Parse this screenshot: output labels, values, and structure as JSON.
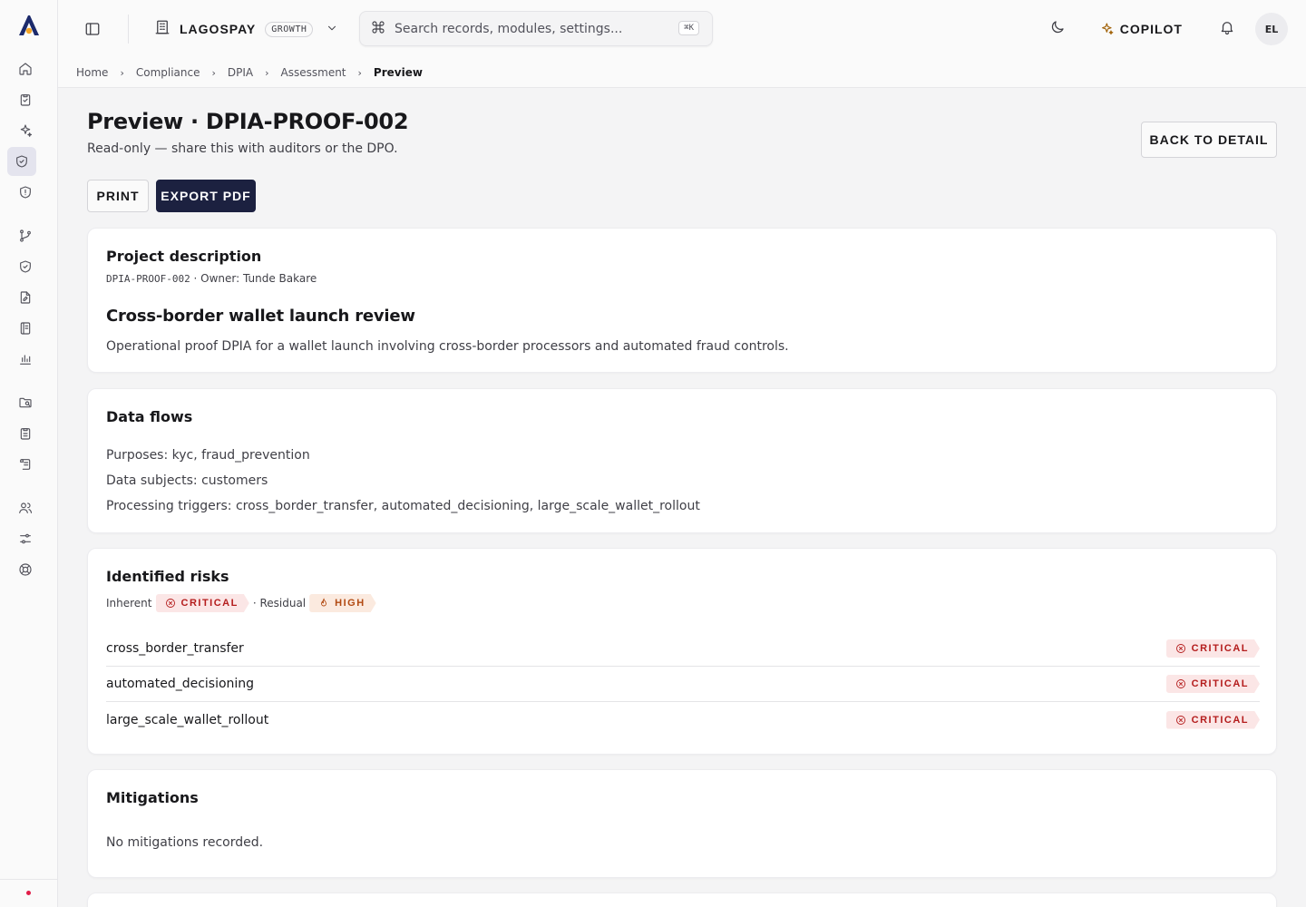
{
  "topbar": {
    "org_name": "LAGOSPAY",
    "plan": "GROWTH",
    "search_placeholder": "Search records, modules, settings...",
    "search_shortcut": "⌘K",
    "copilot_label": "COPILOT",
    "avatar_initials": "EL"
  },
  "breadcrumb": [
    "Home",
    "Compliance",
    "DPIA",
    "Assessment",
    "Preview"
  ],
  "header": {
    "title": "Preview · DPIA-PROOF-002",
    "subtitle": "Read-only — share this with auditors or the DPO.",
    "back_label": "BACK TO DETAIL",
    "print_label": "PRINT",
    "export_label": "EXPORT PDF"
  },
  "project": {
    "section_title": "Project description",
    "id": "DPIA-PROOF-002",
    "owner_text": " · Owner: Tunde Bakare",
    "name": "Cross-border wallet launch review",
    "description": "Operational proof DPIA for a wallet launch involving cross-border processors and automated fraud controls."
  },
  "data_flows": {
    "section_title": "Data flows",
    "purposes": "Purposes: kyc, fraud_prevention",
    "subjects": "Data subjects: customers",
    "triggers": "Processing triggers: cross_border_transfer, automated_decisioning, large_scale_wallet_rollout"
  },
  "risks": {
    "section_title": "Identified risks",
    "inherent_label": "Inherent",
    "inherent_level": "CRITICAL",
    "residual_label": "· Residual",
    "residual_level": "HIGH",
    "items": [
      {
        "name": "cross_border_transfer",
        "level": "CRITICAL"
      },
      {
        "name": "automated_decisioning",
        "level": "CRITICAL"
      },
      {
        "name": "large_scale_wallet_rollout",
        "level": "CRITICAL"
      }
    ]
  },
  "mitigations": {
    "section_title": "Mitigations",
    "empty_text": "No mitigations recorded."
  },
  "colors": {
    "primary": "#1c2140",
    "critical": "#b41c1c",
    "high": "#b24a12",
    "status_dot": "#e11d48"
  }
}
